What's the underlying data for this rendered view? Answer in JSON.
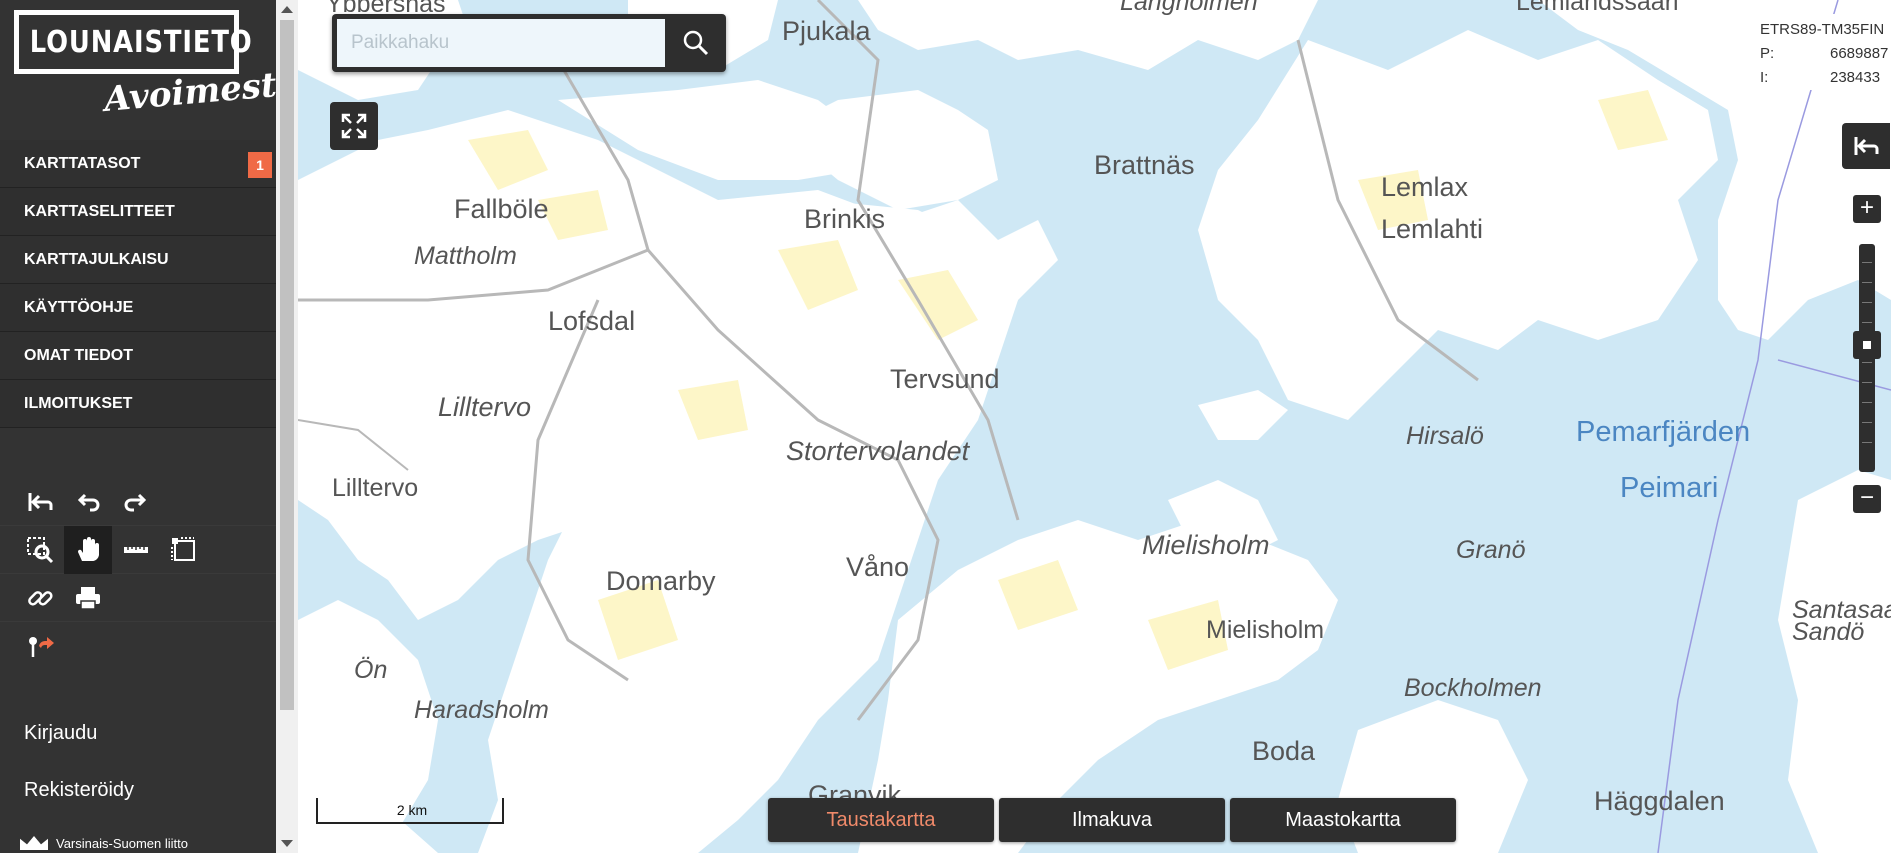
{
  "brand": {
    "logo_main": "LOUNAISTIETO",
    "logo_sub": "Avoimesti"
  },
  "menu": [
    {
      "label": "KARTTATASOT",
      "badge": "1"
    },
    {
      "label": "KARTTASELITTEET"
    },
    {
      "label": "KARTTAJULKAISU"
    },
    {
      "label": "KÄYTTÖOHJE"
    },
    {
      "label": "OMAT TIEDOT"
    },
    {
      "label": "ILMOITUKSET"
    }
  ],
  "tools": {
    "row1": [
      "reset-view-icon",
      "undo-icon",
      "redo-icon"
    ],
    "row2": [
      "zoom-box-icon",
      "pan-hand-icon",
      "measure-line-icon",
      "measure-area-icon"
    ],
    "row3": [
      "link-icon",
      "print-icon"
    ],
    "row4": [
      "marker-share-icon"
    ],
    "active": "pan-hand-icon"
  },
  "auth": {
    "login": "Kirjaudu",
    "register": "Rekisteröidy"
  },
  "footer": {
    "partner": "Varsinais-Suomen liitto"
  },
  "search": {
    "placeholder": "Paikkahaku"
  },
  "coords": {
    "system": "ETRS89-TM35FIN",
    "p_label": "P:",
    "p_value": "6689887",
    "i_label": "I:",
    "i_value": "238433"
  },
  "scale": {
    "label": "2 km"
  },
  "background_maps": [
    {
      "label": "Taustakartta",
      "selected": true
    },
    {
      "label": "Ilmakuva",
      "selected": false
    },
    {
      "label": "Maastokartta",
      "selected": false
    }
  ],
  "places": [
    {
      "name": "Ybbersnäs",
      "style": "mid"
    },
    {
      "name": "Pjukala",
      "style": "big"
    },
    {
      "name": "Långholmen",
      "style": "mid it"
    },
    {
      "name": "Lemlandssaari",
      "style": "mid"
    },
    {
      "name": "Brattnäs",
      "style": "big"
    },
    {
      "name": "Lemlax",
      "style": "big"
    },
    {
      "name": "Lemlahti",
      "style": "big"
    },
    {
      "name": "Fallböle",
      "style": "big"
    },
    {
      "name": "Brinkis",
      "style": "big"
    },
    {
      "name": "Mattholm",
      "style": "mid it"
    },
    {
      "name": "Lofsdal",
      "style": "big"
    },
    {
      "name": "Tervsund",
      "style": "big"
    },
    {
      "name": "Lilltervo",
      "style": "big it"
    },
    {
      "name": "Hirsalö",
      "style": "mid it"
    },
    {
      "name": "Pemarfjärden",
      "style": "water"
    },
    {
      "name": "Peimari",
      "style": "water"
    },
    {
      "name": "Lilltervo",
      "style": "mid"
    },
    {
      "name": "Stortervolandet",
      "style": "big it"
    },
    {
      "name": "Mielisholm",
      "style": "big it"
    },
    {
      "name": "Granö",
      "style": "mid it"
    },
    {
      "name": "Våno",
      "style": "big"
    },
    {
      "name": "Domarby",
      "style": "big"
    },
    {
      "name": "Mielisholm",
      "style": "mid"
    },
    {
      "name": "Santasaari",
      "style": "mid it"
    },
    {
      "name": "Sandö",
      "style": "mid it"
    },
    {
      "name": "Ön",
      "style": "mid it"
    },
    {
      "name": "Haradsholm",
      "style": "mid it"
    },
    {
      "name": "Bockholmen",
      "style": "mid it"
    },
    {
      "name": "Boda",
      "style": "big"
    },
    {
      "name": "Granvik",
      "style": "big"
    },
    {
      "name": "Häggdalen",
      "style": "big"
    }
  ],
  "colors": {
    "water": "#cfe8f5",
    "land": "#ffffff",
    "fields": "#fdf6c8",
    "accent": "#f06a46",
    "panel": "#333333"
  }
}
